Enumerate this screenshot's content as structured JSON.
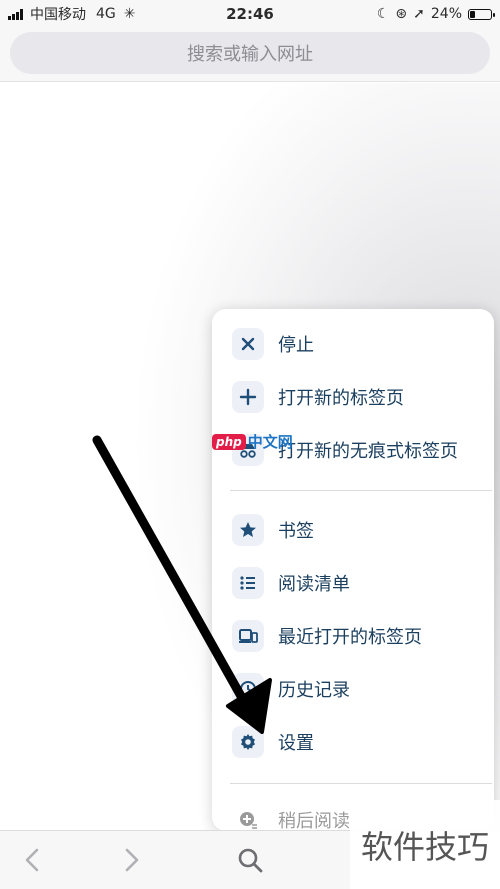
{
  "status_bar": {
    "carrier": "中国移动",
    "network": "4G",
    "time": "22:46",
    "battery_pct": "24%",
    "battery_level": 0.24
  },
  "address_bar": {
    "placeholder": "搜索或输入网址"
  },
  "menu": {
    "items": [
      {
        "label": "停止",
        "icon": "close-icon"
      },
      {
        "label": "打开新的标签页",
        "icon": "plus-icon"
      },
      {
        "label": "打开新的无痕式标签页",
        "icon": "incognito-icon"
      },
      {
        "label": "书签",
        "icon": "star-icon"
      },
      {
        "label": "阅读清单",
        "icon": "list-icon"
      },
      {
        "label": "最近打开的标签页",
        "icon": "devices-icon"
      },
      {
        "label": "历史记录",
        "icon": "history-icon"
      },
      {
        "label": "设置",
        "icon": "gear-icon"
      },
      {
        "label": "稍后阅读",
        "icon": "add-reading-icon"
      }
    ]
  },
  "watermark": {
    "badge": "php",
    "site": "中文网",
    "corner_text": "软件技巧"
  },
  "toolbar": {
    "back_icon": "chevron-left-icon",
    "forward_icon": "chevron-right-icon",
    "search_icon": "search-icon"
  },
  "colors": {
    "menu_text": "#1b3f5e",
    "menu_icon_bg": "#edf1f7",
    "toolbar_icon": "#8e8e93",
    "arrow": "#000000"
  }
}
